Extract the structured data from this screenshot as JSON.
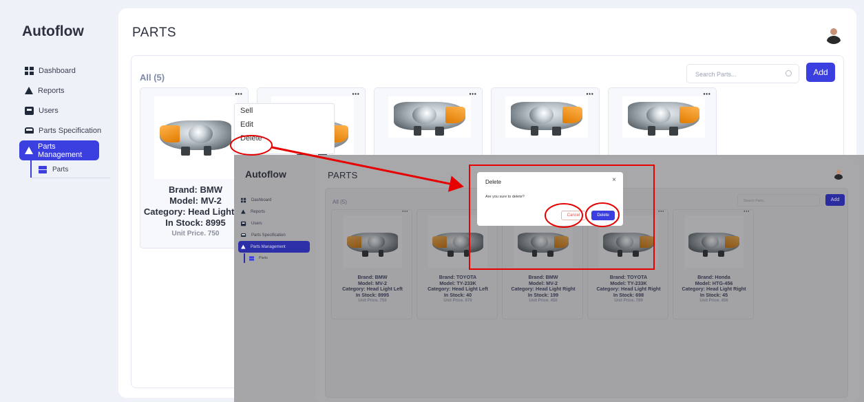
{
  "app": {
    "brand": "Autoflow",
    "page_title": "PARTS"
  },
  "sidebar": {
    "items": [
      {
        "label": "Dashboard",
        "icon": "dashboard-grid-icon"
      },
      {
        "label": "Reports",
        "icon": "reports-icon"
      },
      {
        "label": "Users",
        "icon": "users-icon"
      },
      {
        "label": "Parts Specification",
        "icon": "bus-icon"
      },
      {
        "label": "Parts Management",
        "icon": "parts-management-icon",
        "active": true
      }
    ],
    "subitem": {
      "label": "Parts",
      "icon": "parts-list-icon"
    }
  },
  "list": {
    "filter_label": "All (5)",
    "search_placeholder": "Search Parts...",
    "add_label": "Add",
    "more_label": "···"
  },
  "context_menu": {
    "items": [
      "Sell",
      "Edit",
      "Delete"
    ]
  },
  "parts": [
    {
      "brand": "Brand: BMW",
      "model": "Model: MV-2",
      "category": "Category: Head Light Left",
      "stock": "In Stock: 8995",
      "price": "Unit Price. 750"
    },
    {
      "brand": "Brand: TOYOTA",
      "model": "Model: TY-233K",
      "category": "Category: Head Light Left",
      "stock": "In Stock: 40",
      "price": "Unit Price. 670"
    },
    {
      "brand": "Brand: BMW",
      "model": "Model: MV-2",
      "category": "Category: Head Light Right",
      "stock": "In Stock: 199",
      "price": "Unit Price. 450"
    },
    {
      "brand": "Brand: TOYOTA",
      "model": "Model: TY-233K",
      "category": "Category: Head Light Right",
      "stock": "In Stock: 698",
      "price": "Unit Price. 789"
    },
    {
      "brand": "Brand: Honda",
      "model": "Model: HTG-456",
      "category": "Category: Head Light Right",
      "stock": "In Stock: 45",
      "price": "Unit Price. 456"
    }
  ],
  "main_card_visible": {
    "brand": "Brand: BMW",
    "model": "Model: MV-2",
    "category": "Category: Head Light Le",
    "stock": "In Stock: 8995",
    "price": "Unit Price. 750"
  },
  "dialog": {
    "title": "Delete",
    "close": "×",
    "message": "Are you sure to delete?",
    "cancel_label": "Cancel",
    "delete_label": "Delete"
  },
  "colors": {
    "accent": "#3b3fe0",
    "annotation": "#e60000",
    "sidebar_bg": "#eef1f8",
    "amber": "#f0900a"
  }
}
